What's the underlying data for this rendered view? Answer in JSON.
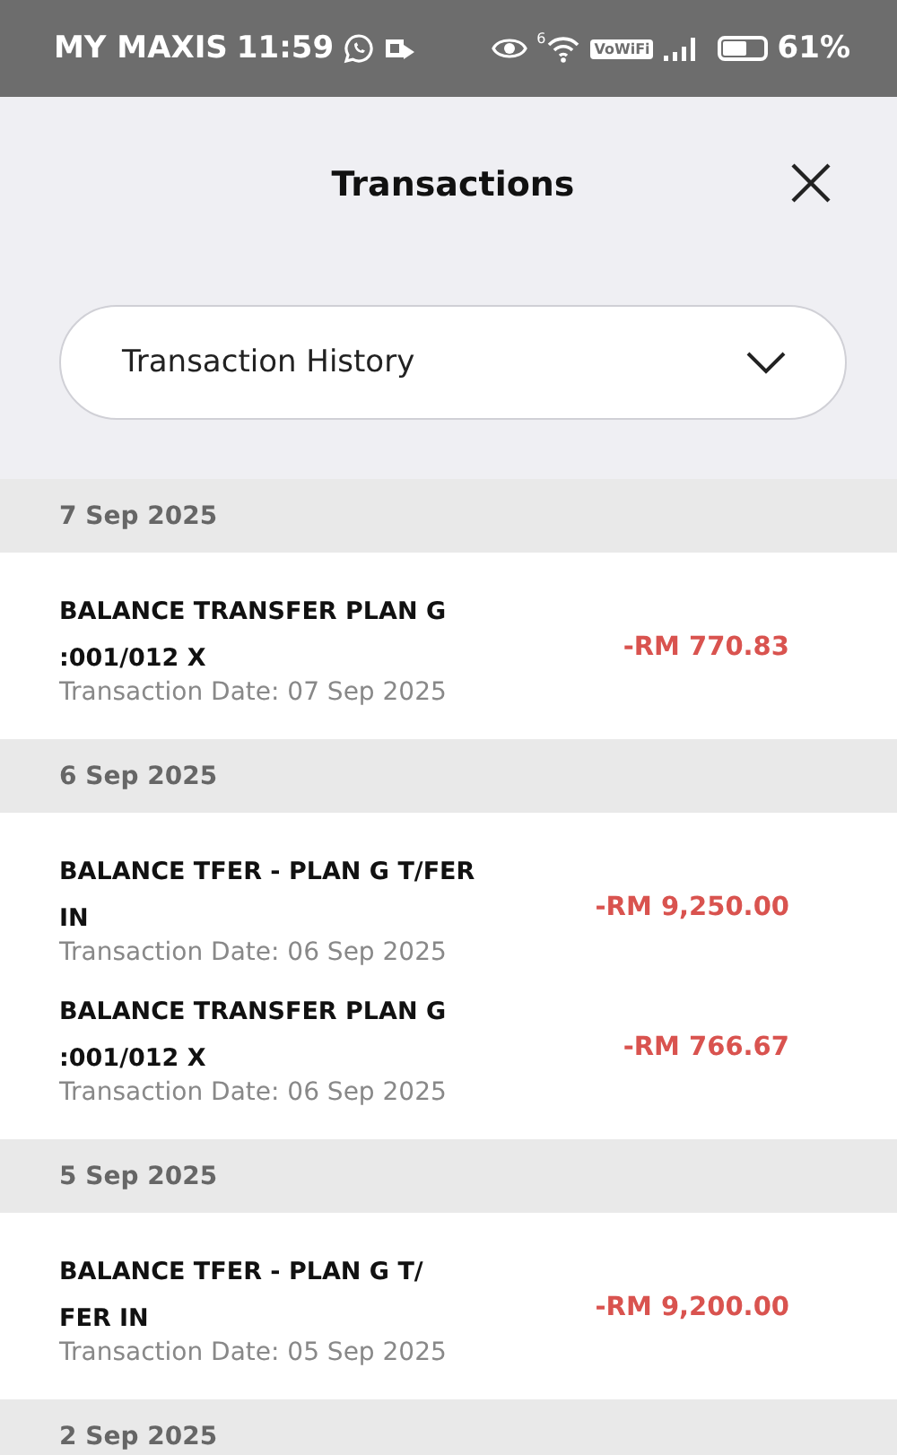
{
  "status_bar": {
    "carrier": "MY MAXIS",
    "time": "11:59",
    "wifi_generation": "6",
    "vowifi": "VoWiFi",
    "battery_text": "61%"
  },
  "header": {
    "title": "Transactions"
  },
  "dropdown": {
    "value": "Transaction History"
  },
  "groups": [
    {
      "date": "7 Sep 2025",
      "items": [
        {
          "title_lines": [
            "BALANCE TRANSFER PLAN G",
            ":001/012 X"
          ],
          "date": "Transaction Date: 07 Sep 2025",
          "amount": "-RM 770.83"
        }
      ]
    },
    {
      "date": "6 Sep 2025",
      "items": [
        {
          "title_lines": [
            "BALANCE TFER - PLAN G T/FER",
            "IN"
          ],
          "date": "Transaction Date: 06 Sep 2025",
          "amount": "-RM 9,250.00"
        },
        {
          "title_lines": [
            "BALANCE TRANSFER PLAN G",
            ":001/012 X"
          ],
          "date": "Transaction Date: 06 Sep 2025",
          "amount": "-RM 766.67"
        }
      ]
    },
    {
      "date": "5 Sep 2025",
      "items": [
        {
          "title_lines": [
            "BALANCE TFER - PLAN G T/",
            "FER IN"
          ],
          "date": "Transaction Date: 05 Sep 2025",
          "amount": "-RM 9,200.00"
        }
      ]
    },
    {
      "date": "2 Sep 2025"
    }
  ]
}
